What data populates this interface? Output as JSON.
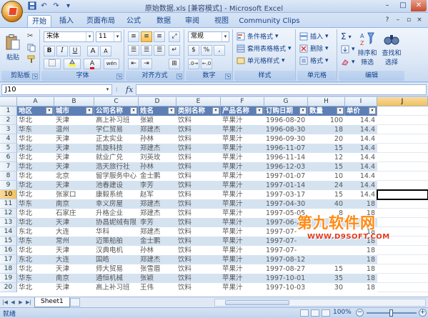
{
  "window": {
    "title": "原始数据.xls  [兼容模式] - Microsoft Excel",
    "controls": [
      "–",
      "□",
      "✕"
    ]
  },
  "tabs": [
    {
      "label": "开始",
      "active": true
    },
    {
      "label": "插入",
      "active": false
    },
    {
      "label": "页面布局",
      "active": false
    },
    {
      "label": "公式",
      "active": false
    },
    {
      "label": "数据",
      "active": false
    },
    {
      "label": "审阅",
      "active": false
    },
    {
      "label": "视图",
      "active": false
    },
    {
      "label": "Community Clips",
      "active": false
    }
  ],
  "ribbon": {
    "clipboard": {
      "label": "剪贴板",
      "paste": "粘贴"
    },
    "font": {
      "label": "字体",
      "name": "宋体",
      "size": "11",
      "bold": "B",
      "italic": "I",
      "underline": "U",
      "grow": "A",
      "shrink": "A",
      "fontcolor": "A",
      "phonetic": "wén"
    },
    "alignment": {
      "label": "对齐方式"
    },
    "number": {
      "label": "数字",
      "format": "常规",
      "percent": "%",
      "comma": ",",
      "currency": "$"
    },
    "styles": {
      "label": "样式",
      "conditional": "条件格式",
      "table": "套用表格格式",
      "cell": "单元格样式"
    },
    "cells": {
      "label": "单元格",
      "insert": "插入",
      "delete": "删除",
      "format": "格式"
    },
    "editing": {
      "label": "编辑",
      "sigma": "Σ",
      "sort": "排序和",
      "sort2": "筛选",
      "find": "查找和",
      "find2": "选择"
    }
  },
  "formula_bar": {
    "name_box": "J10",
    "fx": "fx",
    "value": ""
  },
  "columns": [
    "A",
    "B",
    "C",
    "D",
    "E",
    "F",
    "G",
    "H",
    "I",
    "J"
  ],
  "selected_cell": "J10",
  "header_row": [
    "地区",
    "城市",
    "公司名称",
    "姓名",
    "类别名称",
    "产品名称",
    "订购日期",
    "数量",
    "单价"
  ],
  "rows": [
    [
      "华北",
      "天津",
      "高上补习班",
      "张颖",
      "饮料",
      "苹果汁",
      "1996-08-20",
      "100",
      "14.4"
    ],
    [
      "华东",
      "温州",
      "学仁贸易",
      "郑建杰",
      "饮料",
      "苹果汁",
      "1996-08-30",
      "18",
      "14.4"
    ],
    [
      "华北",
      "天津",
      "正太实业",
      "孙林",
      "饮料",
      "苹果汁",
      "1996-09-30",
      "20",
      "14.4"
    ],
    [
      "华北",
      "天津",
      "凯旋科技",
      "郑建杰",
      "饮料",
      "苹果汁",
      "1996-11-07",
      "15",
      "14.4"
    ],
    [
      "华北",
      "天津",
      "就业广兑",
      "刘英玫",
      "饮料",
      "苹果汁",
      "1996-11-14",
      "12",
      "14.4"
    ],
    [
      "华北",
      "天津",
      "浩天旅行社",
      "孙林",
      "饮料",
      "苹果汁",
      "1996-12-03",
      "15",
      "14.4"
    ],
    [
      "华北",
      "北京",
      "留学服务中心",
      "金士鹏",
      "饮料",
      "苹果汁",
      "1997-01-07",
      "10",
      "14.4"
    ],
    [
      "华北",
      "天津",
      "池春建设",
      "李芳",
      "饮料",
      "苹果汁",
      "1997-01-14",
      "24",
      "14.4"
    ],
    [
      "华北",
      "张家口",
      "康毅系统",
      "赵军",
      "饮料",
      "苹果汁",
      "1997-03-17",
      "15",
      "14.4"
    ],
    [
      "华东",
      "南京",
      "幸义房屋",
      "郑建杰",
      "饮料",
      "苹果汁",
      "1997-04-30",
      "40",
      "18"
    ],
    [
      "华北",
      "石家庄",
      "升格企业",
      "郑建杰",
      "饮料",
      "苹果汁",
      "1997-05-05",
      "8",
      "18"
    ],
    [
      "华北",
      "天津",
      "协昌妮绒有限",
      "李芳",
      "饮料",
      "苹果汁",
      "1997-06-23",
      "",
      "18"
    ],
    [
      "东北",
      "大连",
      "华科",
      "郑建杰",
      "饮料",
      "苹果汁",
      "1997-07-",
      "",
      "18"
    ],
    [
      "华东",
      "常州",
      "迈策船舶",
      "金士鹏",
      "饮料",
      "苹果汁",
      "1997-07-",
      "",
      "18"
    ],
    [
      "华北",
      "天津",
      "汉典电机",
      "孙林",
      "饮料",
      "苹果汁",
      "1997-07-",
      "",
      "18"
    ],
    [
      "东北",
      "大连",
      "国皓",
      "郑建杰",
      "饮料",
      "苹果汁",
      "1997-08-12",
      "",
      "18"
    ],
    [
      "华北",
      "天津",
      "师大贸易",
      "张雪眉",
      "饮料",
      "苹果汁",
      "1997-08-27",
      "15",
      "18"
    ],
    [
      "华东",
      "南京",
      "通恒机械",
      "张颖",
      "饮料",
      "苹果汁",
      "1997-10-01",
      "35",
      "18"
    ],
    [
      "华北",
      "天津",
      "高上补习班",
      "王伟",
      "饮料",
      "苹果汁",
      "1997-10-03",
      "30",
      "18"
    ]
  ],
  "sheet_tab": "Sheet1",
  "status": {
    "ready": "就绪",
    "zoom": "100%"
  },
  "watermark": {
    "line1": "第九软件网",
    "line2": "WWW.D9SOFT.COM"
  }
}
